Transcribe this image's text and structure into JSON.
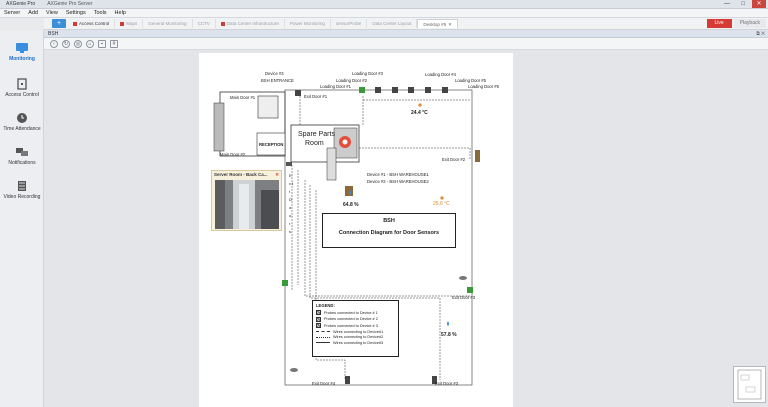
{
  "window": {
    "tabs": [
      "AXGenie Pro",
      "AXGenie Pro Server"
    ],
    "controls": [
      "—",
      "□",
      "✕"
    ]
  },
  "menu": [
    "Server",
    "Add",
    "View",
    "Settings",
    "Tools",
    "Help"
  ],
  "tabs": [
    {
      "label": "Access Control",
      "state": "strong",
      "marker": true
    },
    {
      "label": "Maps",
      "state": "faded",
      "marker": true
    },
    {
      "label": "General Monitoring",
      "state": "faded",
      "marker": false
    },
    {
      "label": "CCTV",
      "state": "faded",
      "marker": false
    },
    {
      "label": "Data Center Infrastructure",
      "state": "faded",
      "marker": true
    },
    {
      "label": "Power Monitoring",
      "state": "faded",
      "marker": false
    },
    {
      "label": "sensorProbe",
      "state": "faded",
      "marker": false
    },
    {
      "label": "Data Center Layout",
      "state": "faded",
      "marker": false
    },
    {
      "label": "Desktop #5",
      "state": "active",
      "marker": false
    }
  ],
  "tab_actions": {
    "live": "Live",
    "playback": "Playback"
  },
  "sidebar": [
    {
      "label": "Monitoring",
      "icon": "monitor-icon",
      "active": true
    },
    {
      "label": "Access Control",
      "icon": "access-control-icon",
      "active": false
    },
    {
      "label": "Time Attendance",
      "icon": "clock-icon",
      "active": false
    },
    {
      "label": "Notifications",
      "icon": "notifications-icon",
      "active": false
    },
    {
      "label": "Video Recording",
      "icon": "video-recording-icon",
      "active": false
    }
  ],
  "view_title": "BSH",
  "diagram": {
    "device3": "Device #3",
    "bsh_entrance": "BSH ENTRANCE",
    "main_door1": "Main Door #1",
    "main_door2": "Main Door #2",
    "reception": "RECEPTION",
    "spare_parts": [
      "Spare Parts",
      "Room"
    ],
    "exit_door1": "Exit Door #1",
    "exit_door2": "Exit Door #2",
    "exit_door3": "Exit Door #3",
    "exit_door4": "Exit Door #4",
    "exit_door5": "Exit Door #5",
    "exit_door3_bottom": "Exit Door #3",
    "loading_doors": [
      "Loading Door #3",
      "Loading Door #2",
      "Loading Door #1",
      "Loading Door #4",
      "Loading Door #5",
      "Loading Door #6"
    ],
    "device1": "Device #1 - BSH WAREHOUSE1",
    "device2": "Device #2 - BSH WAREHOUSE2",
    "temp1": "24.4 °C",
    "temp2": "25.6 °C",
    "hum1": "64.8 %",
    "hum2": "57.8 %",
    "exit_doors_vertical": "E x i t   D o o r s",
    "title1": "BSH",
    "title2": "Connection Diagram for Door Sensors",
    "legend_title": "LEGEND:",
    "legend": [
      "Probes connected to Device # 1",
      "Probes connected to Device # 2",
      "Probes connected to Device # 3",
      "Wires connecting to Device#1",
      "Wires connecting to Device#2",
      "Wires connecting to Device#3"
    ]
  },
  "camera": {
    "title": "Server Room - Back Ca...",
    "close": "✕"
  },
  "colors": {
    "accent": "#3b8fd8",
    "live": "#d63a35",
    "sidebar_active": "#1d6fc1"
  }
}
